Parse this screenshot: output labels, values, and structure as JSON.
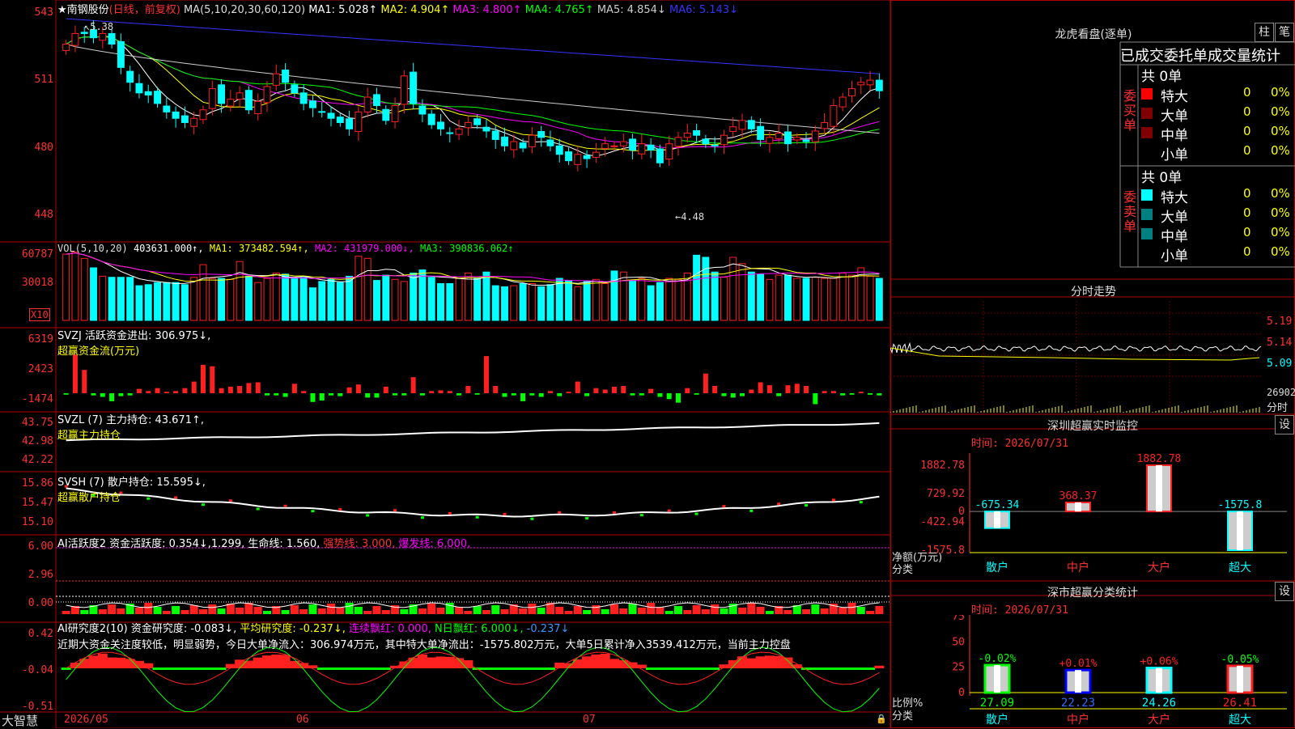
{
  "stock": {
    "name_label": "★南钢股份",
    "period_label": "(日线，前复权)",
    "ma_label": "MA(5,10,20,30,60,120)",
    "ma_values": [
      {
        "name": "MA1: 5.028↑",
        "color": "#ffffff"
      },
      {
        "name": "MA2: 4.904↑",
        "color": "#ffff00"
      },
      {
        "name": "MA3: 4.800↑",
        "color": "#ff00ff"
      },
      {
        "name": "MA4: 4.765↑",
        "color": "#00ff00"
      },
      {
        "name": "MA5: 4.854↓",
        "color": "#cccccc"
      },
      {
        "name": "MA6: 5.143↓",
        "color": "#3333ff"
      }
    ],
    "price_axis": [
      "543",
      "511",
      "480",
      "448"
    ],
    "high_marker": "5.38",
    "low_marker": "←4.48"
  },
  "candles": {
    "closes": [
      5.28,
      5.33,
      5.33,
      5.31,
      5.33,
      5.28,
      5.17,
      5.1,
      5.05,
      5.04,
      5.0,
      4.96,
      4.93,
      4.91,
      4.93,
      4.97,
      5.07,
      5.0,
      5.02,
      5.05,
      4.97,
      5.01,
      5.08,
      5.14,
      5.1,
      5.05,
      5.0,
      4.98,
      4.96,
      4.93,
      4.91,
      4.88,
      4.96,
      5.03,
      4.99,
      4.92,
      4.99,
      5.13,
      5.0,
      4.95,
      4.9,
      4.88,
      4.86,
      4.88,
      4.91,
      4.9,
      4.87,
      4.83,
      4.8,
      4.82,
      4.79,
      4.85,
      4.84,
      4.8,
      4.76,
      4.73,
      4.76,
      4.74,
      4.77,
      4.81,
      4.8,
      4.82,
      4.78,
      4.81,
      4.78,
      4.72,
      4.81,
      4.84,
      4.86,
      4.85,
      4.81,
      4.8,
      4.85,
      4.89,
      4.92,
      4.88,
      4.83,
      4.84,
      4.86,
      4.81,
      4.84,
      4.82,
      4.87,
      4.91,
      4.99,
      5.03,
      5.07,
      5.1,
      5.11,
      5.06
    ],
    "colors": "mixed red (up) / cyan (down)"
  },
  "volume": {
    "label": "VOL(5,10,20)",
    "value": "403631.000↑,",
    "ma1": "MA1: 373482.594↑,",
    "ma2": "MA2: 431979.000↓,",
    "ma3": "MA3: 390836.062↑",
    "axis": [
      "60787",
      "30018"
    ],
    "multiplier": "X10",
    "bars": [
      6.3,
      6.5,
      5.9,
      5.0,
      4.2,
      4.1,
      4.1,
      4.1,
      3.3,
      3.4,
      3.6,
      3.6,
      3.6,
      3.4,
      4.1,
      5.3,
      4.0,
      4.0,
      3.9,
      5.6,
      4.2,
      3.6,
      4.0,
      4.5,
      4.4,
      4.0,
      4.1,
      3.1,
      3.7,
      3.9,
      3.6,
      4.2,
      6.1,
      5.9,
      3.8,
      4.3,
      3.9,
      3.7,
      4.5,
      4.8,
      4.1,
      3.5,
      3.5,
      4.0,
      4.5,
      4.0,
      4.6,
      3.3,
      3.2,
      3.3,
      3.5,
      3.5,
      3.2,
      3.4,
      4.0,
      3.8,
      3.2,
      3.7,
      3.9,
      3.5,
      4.7,
      4.6,
      3.8,
      4.0,
      3.3,
      3.6,
      4.0,
      3.9,
      4.5,
      6.2,
      6.0,
      4.6,
      4.1,
      6.0,
      5.4,
      4.6,
      4.4,
      3.9,
      4.3,
      4.3,
      4.0,
      4.0,
      4.1,
      4.0,
      4.0,
      4.5,
      4.3,
      5.0,
      4.2,
      4.0
    ]
  },
  "svzj": {
    "label": "SVZJ  活跃资金进出: 306.975↓,",
    "sublabel": "超赢资金流(万元)",
    "axis": [
      "6319",
      "2423",
      "-1474"
    ],
    "bars": [
      -200,
      5300,
      3200,
      -300,
      -500,
      -1100,
      -400,
      -300,
      600,
      300,
      700,
      200,
      300,
      700,
      1600,
      3900,
      3700,
      700,
      900,
      1000,
      1400,
      1500,
      -300,
      -300,
      -500,
      1300,
      300,
      -1200,
      -1000,
      -300,
      -400,
      800,
      1200,
      -600,
      -600,
      900,
      -300,
      -300,
      2200,
      -300,
      300,
      400,
      300,
      -300,
      1000,
      -200,
      5100,
      1000,
      -500,
      -300,
      -1100,
      -300,
      -500,
      300,
      -400,
      200,
      1600,
      -400,
      700,
      500,
      900,
      1000,
      -300,
      -300,
      600,
      -500,
      -800,
      -1300,
      700,
      -200,
      2700,
      1000,
      -400,
      -600,
      -400,
      500,
      1500,
      1100,
      -400,
      1100,
      1300,
      1000,
      -1500,
      300,
      300,
      -300,
      -200,
      200,
      -200,
      -300
    ],
    "zero_label": ""
  },
  "svzl": {
    "label": "SVZL (7) 主力持仓: 43.671↑,",
    "sublabel": "超赢主力持仓",
    "axis": [
      "43.75",
      "42.98",
      "42.22"
    ]
  },
  "svsh": {
    "label": "SVSH (7) 散户持仓: 15.595↓,",
    "sublabel": "超赢散户持仓",
    "axis": [
      "15.86",
      "15.47",
      "15.10"
    ]
  },
  "ai_active": {
    "label": "AI活跃度2 资金活跃度: 0.354↓,1.299, 生命线: 1.560,",
    "strong": "强势线: 3.000,",
    "burst": "爆发线: 6.000,",
    "axis": [
      "6.00",
      "2.96",
      "0.00"
    ]
  },
  "ai_research": {
    "label": "AI研究度2(10) 资金研究度: -0.083↓,",
    "avg": "平均研究度: -0.237↓,",
    "streak": "连续飘红: 0.000,",
    "nday": "N日飘红: 6.000↓,",
    "extra": "-0.237↓",
    "comment": "近期大资金关注度较低，明显弱势，今日大单净流入：306.974万元，其中特大单净流出：-1575.802万元，大单5日累计净入3539.412万元，当前主力控盘",
    "axis": [
      "0.42",
      "-0.04",
      "-0.51"
    ]
  },
  "bottom_axis": {
    "brand": "大智慧",
    "dates": [
      "2026/05",
      "06",
      "07"
    ]
  },
  "dragon_tiger": {
    "title": "龙虎看盘(逐单)",
    "btn_bar": "柱",
    "btn_pen": "笔",
    "tabs": [
      "已成交",
      "委托单",
      "成交量统计"
    ],
    "buy_side_label": [
      "委",
      "买",
      "单"
    ],
    "sell_side_label": [
      "委",
      "卖",
      "单"
    ],
    "buy_total": "共 0单",
    "sell_total": "共 0单",
    "rows": [
      {
        "name": "特大",
        "count": "0",
        "pct": "0%"
      },
      {
        "name": "大单",
        "count": "0",
        "pct": "0%"
      },
      {
        "name": "中单",
        "count": "0",
        "pct": "0%"
      },
      {
        "name": "小单",
        "count": "0",
        "pct": "0%"
      }
    ]
  },
  "intraday": {
    "title": "分时走势",
    "axis": [
      "5.19",
      "5.14",
      "5.09"
    ],
    "vol_label": "26902",
    "vol_unit": "分时"
  },
  "sz_monitor": {
    "title": "深圳超赢实时监控",
    "setting": "设",
    "time": "时间: 2026/07/31",
    "axis": [
      "1882.78",
      "729.92",
      "0",
      "-422.94",
      "-1575.8"
    ],
    "ylabel1": "净额(万元)",
    "ylabel2": "分类",
    "categories": [
      "散户",
      "中户",
      "大户",
      "超大"
    ],
    "values": [
      -675.34,
      368.37,
      1882.78,
      -1575.8
    ],
    "value_labels": [
      "-675.34",
      "368.37",
      "1882.78",
      "-1575.8"
    ]
  },
  "sz_stats": {
    "title": "深市超赢分类统计",
    "setting": "设",
    "time": "时间: 2026/07/31",
    "axis": [
      "75",
      "50",
      "25",
      "0"
    ],
    "ylabel1": "比例%",
    "ylabel2": "分类",
    "categories": [
      "散户",
      "中户",
      "大户",
      "超大"
    ],
    "values": [
      27.09,
      22.23,
      24.26,
      26.41
    ],
    "changes": [
      "-0.02%",
      "+0.01%",
      "+0.06%",
      "-0.05%"
    ]
  },
  "colors": {
    "up": "#ff2020",
    "down": "#00ffff",
    "green": "#00ff00",
    "frame": "#b00000",
    "axis_text": "#ff3030"
  }
}
